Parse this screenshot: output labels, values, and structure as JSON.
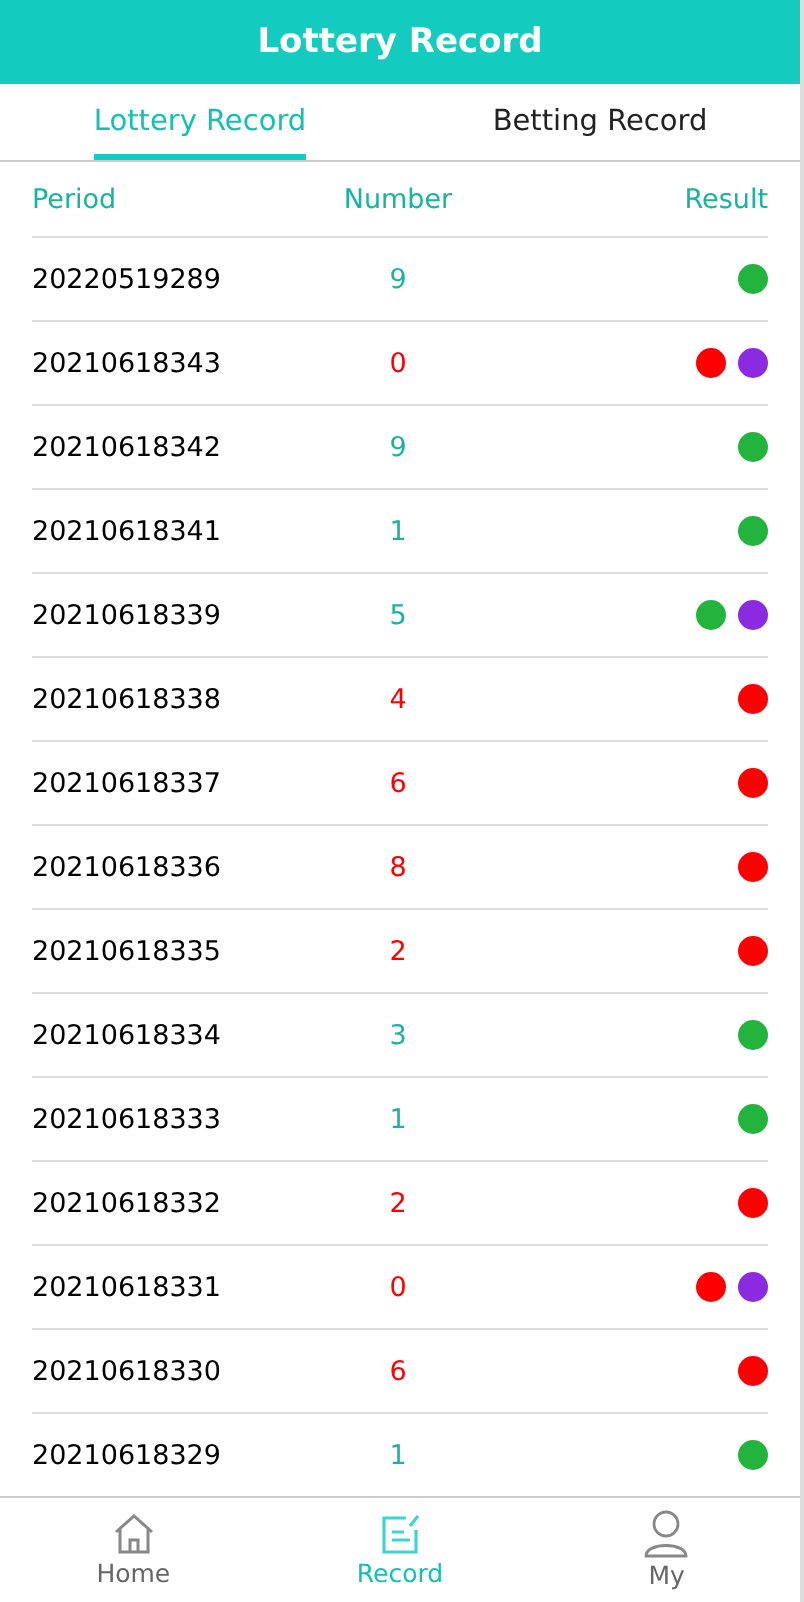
{
  "header": {
    "title": "Lottery Record"
  },
  "tabs": [
    {
      "label": "Lottery Record",
      "selected": true
    },
    {
      "label": "Betting Record",
      "selected": false
    }
  ],
  "table": {
    "columns": [
      "Period",
      "Number",
      "Result"
    ],
    "rows": [
      {
        "period": "20220519289",
        "number": "9",
        "color": "#1ab39f",
        "results": [
          {
            "color": "#22b43c"
          }
        ]
      },
      {
        "period": "20210618343",
        "number": "0",
        "color": "#ff0000",
        "results": [
          {
            "color": "#ff0000"
          },
          {
            "color": "#8a2be2"
          }
        ]
      },
      {
        "period": "20210618342",
        "number": "9",
        "color": "#1ab39f",
        "results": [
          {
            "color": "#22b43c"
          }
        ]
      },
      {
        "period": "20210618341",
        "number": "1",
        "color": "#1ab39f",
        "results": [
          {
            "color": "#22b43c"
          }
        ]
      },
      {
        "period": "20210618339",
        "number": "5",
        "color": "#1ab39f",
        "results": [
          {
            "color": "#22b43c"
          },
          {
            "color": "#8a2be2"
          }
        ]
      },
      {
        "period": "20210618338",
        "number": "4",
        "color": "#ff0000",
        "results": [
          {
            "color": "#ff0000"
          }
        ]
      },
      {
        "period": "20210618337",
        "number": "6",
        "color": "#ff0000",
        "results": [
          {
            "color": "#ff0000"
          }
        ]
      },
      {
        "period": "20210618336",
        "number": "8",
        "color": "#ff0000",
        "results": [
          {
            "color": "#ff0000"
          }
        ]
      },
      {
        "period": "20210618335",
        "number": "2",
        "color": "#ff0000",
        "results": [
          {
            "color": "#ff0000"
          }
        ]
      },
      {
        "period": "20210618334",
        "number": "3",
        "color": "#1ab39f",
        "results": [
          {
            "color": "#22b43c"
          }
        ]
      },
      {
        "period": "20210618333",
        "number": "1",
        "color": "#1ab39f",
        "results": [
          {
            "color": "#22b43c"
          }
        ]
      },
      {
        "period": "20210618332",
        "number": "2",
        "color": "#ff0000",
        "results": [
          {
            "color": "#ff0000"
          }
        ]
      },
      {
        "period": "20210618331",
        "number": "0",
        "color": "#ff0000",
        "results": [
          {
            "color": "#ff0000"
          },
          {
            "color": "#8a2be2"
          }
        ]
      },
      {
        "period": "20210618330",
        "number": "6",
        "color": "#ff0000",
        "results": [
          {
            "color": "#ff0000"
          }
        ]
      },
      {
        "period": "20210618329",
        "number": "1",
        "color": "#1ab39f",
        "results": [
          {
            "color": "#22b43c"
          }
        ]
      }
    ]
  },
  "nav": [
    {
      "kind": "home",
      "label": "Home",
      "selected": false
    },
    {
      "kind": "record",
      "label": "Record",
      "selected": true
    },
    {
      "kind": "my",
      "label": "My",
      "selected": false
    }
  ]
}
